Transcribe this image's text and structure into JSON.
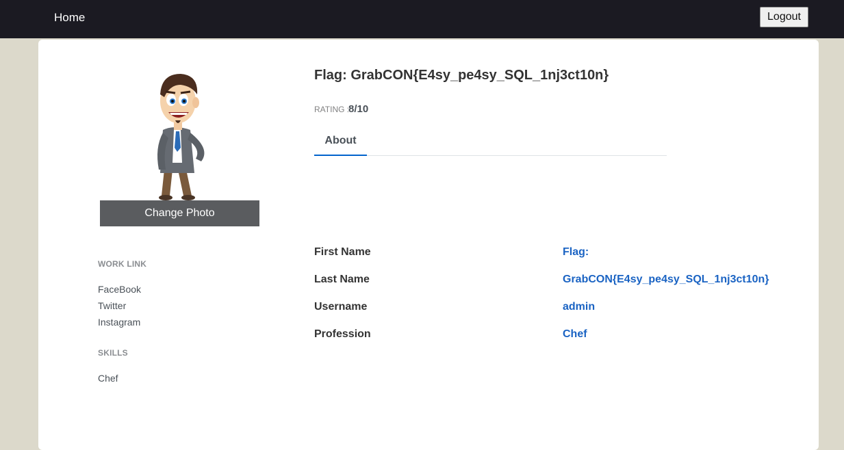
{
  "navbar": {
    "home_label": "Home",
    "logout_label": "Logout"
  },
  "profile": {
    "change_photo_label": "Change Photo",
    "title": "Flag: GrabCON{E4sy_pe4sy_SQL_1nj3ct10n}",
    "rating_label": "RATING :",
    "rating_value": "8/10",
    "tabs": [
      {
        "label": "About",
        "active": true
      }
    ]
  },
  "sidebar": {
    "work_link_heading": "WORK LINK",
    "work_links": [
      "FaceBook",
      "Twitter",
      "Instagram"
    ],
    "skills_heading": "SKILLS",
    "skills": [
      "Chef"
    ]
  },
  "about": {
    "fields": [
      {
        "label": "First Name",
        "value": "Flag:"
      },
      {
        "label": "Last Name",
        "value": "GrabCON{E4sy_pe4sy_SQL_1nj3ct10n}"
      },
      {
        "label": "Username",
        "value": "admin"
      },
      {
        "label": "Profession",
        "value": "Chef"
      }
    ]
  },
  "colors": {
    "navbar_bg": "#1b1a22",
    "page_bg": "#dcd9cb",
    "accent_blue": "#1a63c3",
    "tab_underline": "#0062cc",
    "change_photo_bg": "#5a5c5f"
  },
  "icons": {
    "avatar": "cartoon-businessman-avatar"
  }
}
